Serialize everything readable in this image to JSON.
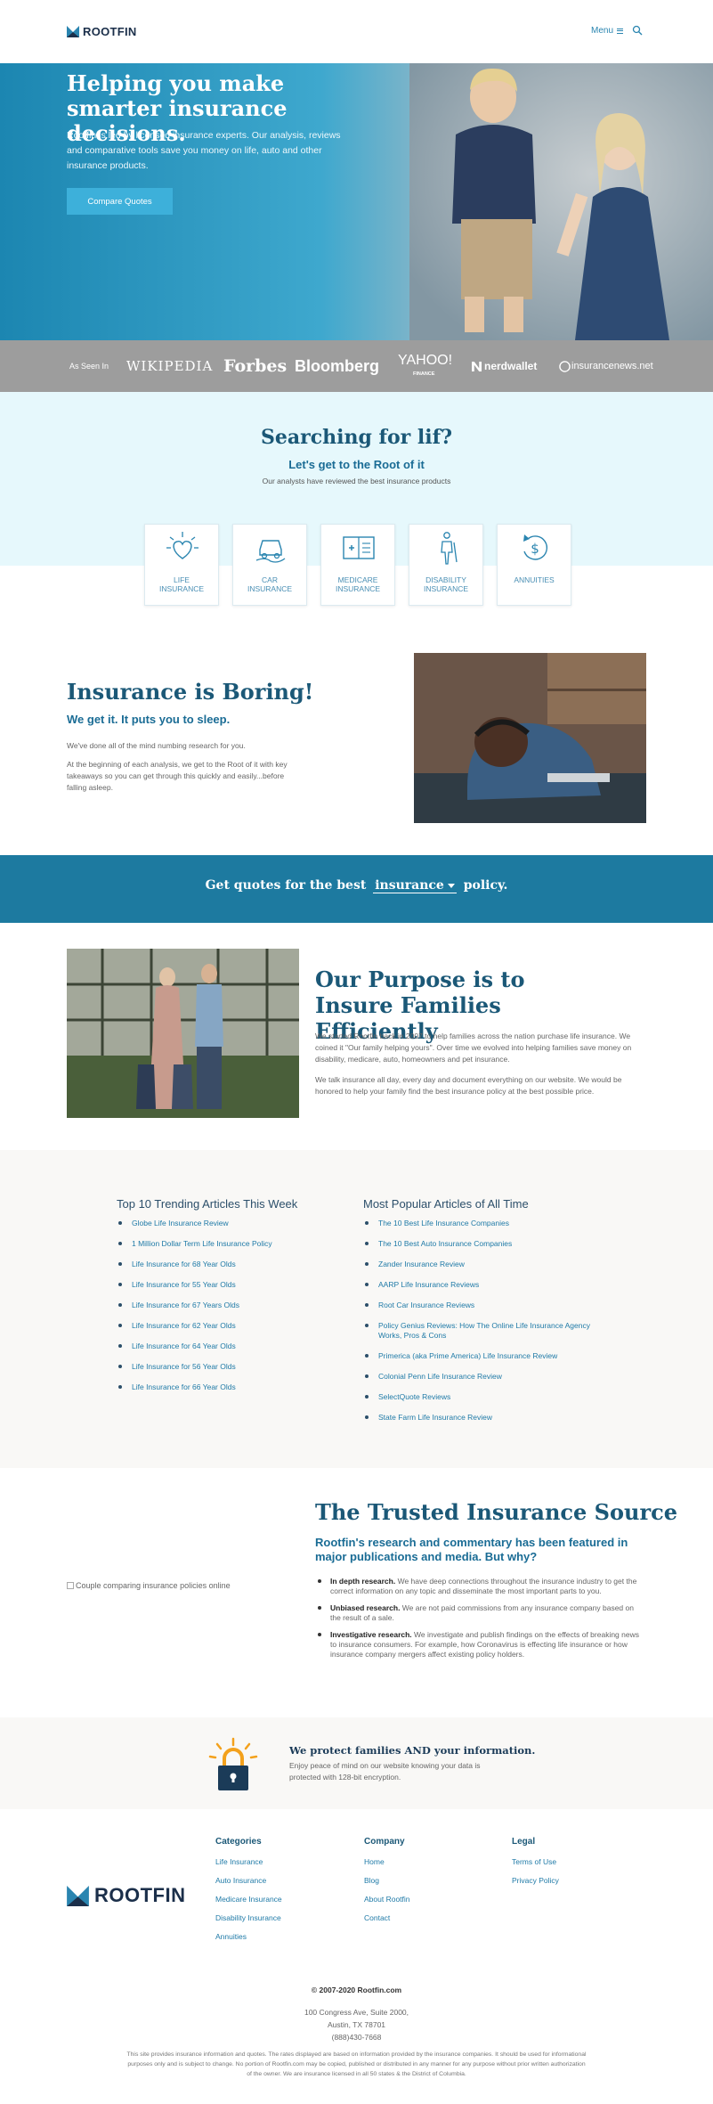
{
  "header": {
    "brand": "ROOTFIN",
    "menu_label": "Menu"
  },
  "hero": {
    "title": "Helping you make smarter insurance decisions.",
    "text": "Rootfin is led by licensed insurance experts. Our analysis, reviews and comparative tools save you money on life, auto and other insurance products.",
    "button": "Compare Quotes"
  },
  "press": {
    "label": "As Seen In",
    "logos": [
      "WIKIPEDIA",
      "Forbes",
      "Bloomberg",
      "YAHOO!",
      "FINANCE",
      "nerdwallet",
      "insurancenews.net"
    ]
  },
  "search": {
    "title": "Searching for lif?",
    "subtitle": "Let's get to the Root of it",
    "note": "Our analysts have reviewed the best insurance products",
    "cards": [
      {
        "line1": "LIFE",
        "line2": "INSURANCE"
      },
      {
        "line1": "CAR",
        "line2": "INSURANCE"
      },
      {
        "line1": "MEDICARE",
        "line2": "INSURANCE"
      },
      {
        "line1": "DISABILITY",
        "line2": "INSURANCE"
      },
      {
        "line1": "ANNUITIES",
        "line2": ""
      }
    ]
  },
  "boring": {
    "title": "Insurance is Boring!",
    "subtitle": "We get it. It puts you to sleep.",
    "p1": "We've done all of the mind numbing research for you.",
    "p2": "At the beginning of each analysis, we get to the Root of it with key takeaways so you can get through this quickly and easily...before falling asleep."
  },
  "quote_banner": {
    "before": "Get quotes for the best",
    "selected": "insurance",
    "after": "policy."
  },
  "purpose": {
    "title": "Our Purpose is to Insure Families Efficiently",
    "p1": "We started Rootfin back in 2007 to help families across the nation purchase life insurance. We coined it \"Our family helping yours\". Over time we evolved into helping families save money on disability, medicare, auto, homeowners and pet insurance.",
    "p2": "We talk insurance all day, every day and document everything on our website. We would be honored to help your family find the best insurance policy at the best possible price."
  },
  "articles": {
    "trending_title": "Top 10 Trending Articles This Week",
    "trending": [
      "Globe Life Insurance Review",
      "1 Million Dollar Term Life Insurance Policy",
      "Life Insurance for 68 Year Olds",
      "Life Insurance for 55 Year Olds",
      "Life Insurance for 67 Years Olds",
      "Life Insurance for 62 Year Olds",
      "Life Insurance for 64 Year Olds",
      "Life Insurance for 56 Year Olds",
      "Life Insurance for 66 Year Olds"
    ],
    "popular_title": "Most Popular Articles of All Time",
    "popular": [
      "The 10 Best Life Insurance Companies",
      "The 10 Best Auto Insurance Companies",
      "Zander Insurance Review",
      "AARP Life Insurance Reviews",
      "Root Car Insurance Reviews",
      "Policy Genius Reviews: How The Online Life Insurance Agency Works, Pros & Cons",
      "Primerica (aka Prime America) Life Insurance Review",
      "Colonial Penn Life Insurance Review",
      "SelectQuote Reviews",
      "State Farm Life Insurance Review"
    ]
  },
  "trusted": {
    "img_alt": "Couple comparing insurance policies online",
    "title": "The Trusted Insurance Source",
    "subtitle": "Rootfin's research and commentary has been featured in major publications and media. But why?",
    "items": [
      {
        "bold": "In depth research.",
        "text": " We have deep connections throughout the insurance industry to get the correct information on any topic and disseminate the most important parts to you."
      },
      {
        "bold": "Unbiased research.",
        "text": " We are not paid commissions from any insurance company based on the result of a sale."
      },
      {
        "bold": "Investigative research.",
        "text": " We investigate and publish findings on the effects of breaking news to insurance consumers. For example, how Coronavirus is effecting life insurance or how insurance company mergers affect existing policy holders."
      }
    ]
  },
  "protect": {
    "title": "We protect families AND your information.",
    "text": "Enjoy peace of mind on our website knowing your data is protected with 128-bit encryption."
  },
  "footer": {
    "brand": "ROOTFIN",
    "categories_title": "Categories",
    "categories": [
      "Life Insurance",
      "Auto Insurance",
      "Medicare Insurance",
      "Disability Insurance",
      "Annuities"
    ],
    "company_title": "Company",
    "company": [
      "Home",
      "Blog",
      "About Rootfin",
      "Contact"
    ],
    "legal_title": "Legal",
    "legal": [
      "Terms of Use",
      "Privacy Policy"
    ],
    "copyright": "© 2007-2020 Rootfin.com",
    "address1": "100 Congress Ave, Suite 2000,",
    "address2": "Austin, TX 78701",
    "phone": "(888)430-7668",
    "disclaimer": "This site provides insurance information and quotes. The rates displayed are based on information provided by the insurance companies. It should be used for informational purposes only and is subject to change. No portion of Rootfin.com may be copied, published or distributed in any manner for any purpose without prior written authorization of the owner. We are insurance licensed in all 50 states & the District of Columbia."
  },
  "colors": {
    "brand": "#1b5877",
    "accent": "#3db0da",
    "banner": "#1d7aa0"
  }
}
